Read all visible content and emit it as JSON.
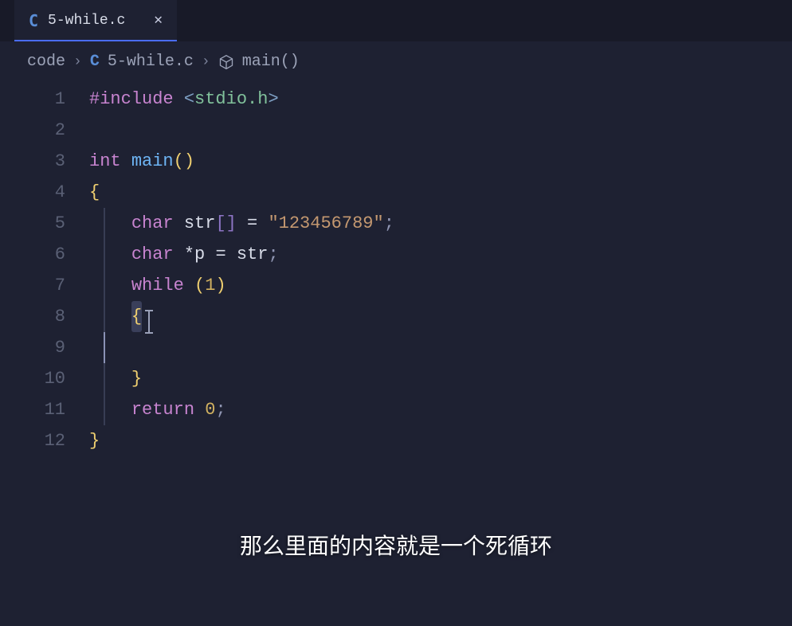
{
  "tab": {
    "icon_letter": "C",
    "filename": "5-while.c",
    "close_glyph": "✕"
  },
  "breadcrumb": {
    "seg1": "code",
    "chevron": "›",
    "c_letter": "C",
    "seg2": "5-while.c",
    "seg3": "main()"
  },
  "gutter": {
    "l1": "1",
    "l2": "2",
    "l3": "3",
    "l4": "4",
    "l5": "5",
    "l6": "6",
    "l7": "7",
    "l8": "8",
    "l9": "9",
    "l10": "10",
    "l11": "11",
    "l12": "12"
  },
  "code": {
    "l1": {
      "prep": "#include",
      "sp": " ",
      "lt": "<",
      "hdr": "stdio.h",
      "gt": ">"
    },
    "l3": {
      "type": "int",
      "sp": " ",
      "fn": "main",
      "p": "()"
    },
    "l4": {
      "br": "{"
    },
    "l5": {
      "ind": "    ",
      "type": "char",
      "sp": " ",
      "id": "str",
      "brk": "[]",
      "sp2": " ",
      "eq": "=",
      "sp3": " ",
      "str": "\"123456789\"",
      "semi": ";"
    },
    "l6": {
      "ind": "    ",
      "type": "char",
      "sp": " ",
      "ptr": "*",
      "id": "p",
      "sp2": " ",
      "eq": "=",
      "sp3": " ",
      "id2": "str",
      "semi": ";"
    },
    "l7": {
      "ind": "    ",
      "kw": "while",
      "sp": " ",
      "po": "(",
      "num": "1",
      "pc": ")"
    },
    "l8": {
      "ind": "    ",
      "br": "{",
      "cursor_after": true
    },
    "l9": {
      "ind": "        "
    },
    "l10": {
      "ind": "    ",
      "br": "}"
    },
    "l11": {
      "ind": "    ",
      "kw": "return",
      "sp": " ",
      "num": "0",
      "semi": ";"
    },
    "l12": {
      "br": "}"
    }
  },
  "subtitle": "那么里面的内容就是一个死循环"
}
